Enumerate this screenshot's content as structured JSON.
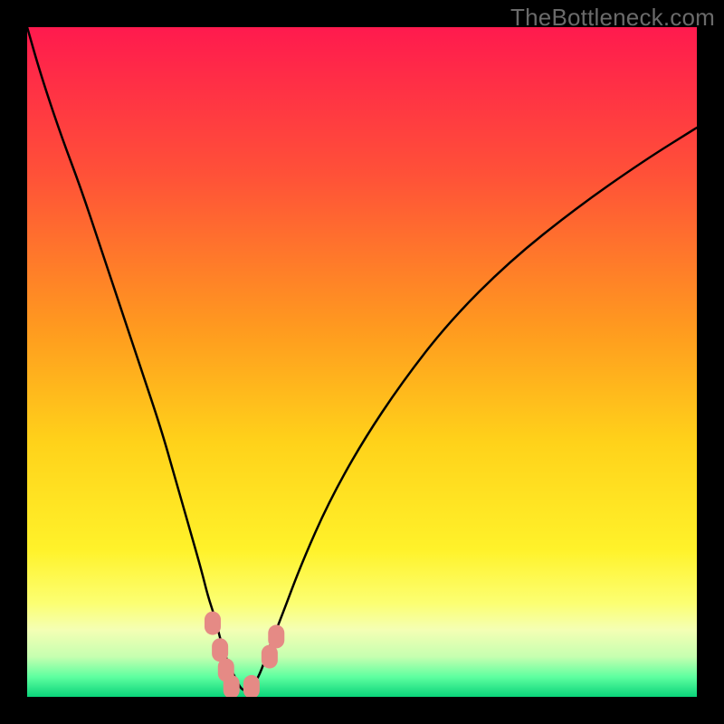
{
  "watermark": "TheBottleneck.com",
  "chart_data": {
    "type": "line",
    "title": "",
    "xlabel": "",
    "ylabel": "",
    "xlim": [
      0,
      100
    ],
    "ylim": [
      0,
      100
    ],
    "grid": false,
    "legend": false,
    "series": [
      {
        "name": "bottleneck-curve",
        "x": [
          0,
          2,
          5,
          8,
          11,
          14,
          17,
          20,
          22,
          24,
          26,
          27,
          28,
          29,
          30,
          31,
          32,
          33,
          34,
          35,
          36,
          38,
          41,
          45,
          50,
          56,
          63,
          72,
          82,
          92,
          100
        ],
        "values": [
          100,
          93,
          84,
          76,
          67,
          58,
          49,
          40,
          33,
          26,
          19,
          15,
          12,
          8,
          5,
          3,
          1,
          1,
          2,
          4,
          7,
          12,
          20,
          29,
          38,
          47,
          56,
          65,
          73,
          80,
          85
        ]
      }
    ],
    "background_gradient": {
      "stops": [
        {
          "offset": 0.0,
          "color": "#ff1a4e"
        },
        {
          "offset": 0.22,
          "color": "#ff5138"
        },
        {
          "offset": 0.45,
          "color": "#ff9a1f"
        },
        {
          "offset": 0.62,
          "color": "#ffd21a"
        },
        {
          "offset": 0.78,
          "color": "#fff22a"
        },
        {
          "offset": 0.86,
          "color": "#fcff72"
        },
        {
          "offset": 0.9,
          "color": "#f4ffb4"
        },
        {
          "offset": 0.94,
          "color": "#c6ffb0"
        },
        {
          "offset": 0.97,
          "color": "#5fffa0"
        },
        {
          "offset": 1.0,
          "color": "#0ad47a"
        }
      ]
    },
    "markers": [
      {
        "name": "marker-descending-1",
        "x": 27.7,
        "y": 11,
        "color": "#e58a85"
      },
      {
        "name": "marker-descending-2",
        "x": 28.8,
        "y": 7,
        "color": "#e58a85"
      },
      {
        "name": "marker-descending-3",
        "x": 29.7,
        "y": 4,
        "color": "#e58a85"
      },
      {
        "name": "marker-bottom-left",
        "x": 30.5,
        "y": 1.5,
        "color": "#e58a85"
      },
      {
        "name": "marker-bottom-right",
        "x": 33.5,
        "y": 1.5,
        "color": "#e58a85"
      },
      {
        "name": "marker-right-1",
        "x": 36.2,
        "y": 6,
        "color": "#e58a85"
      },
      {
        "name": "marker-right-2",
        "x": 37.2,
        "y": 9,
        "color": "#e58a85"
      }
    ]
  }
}
